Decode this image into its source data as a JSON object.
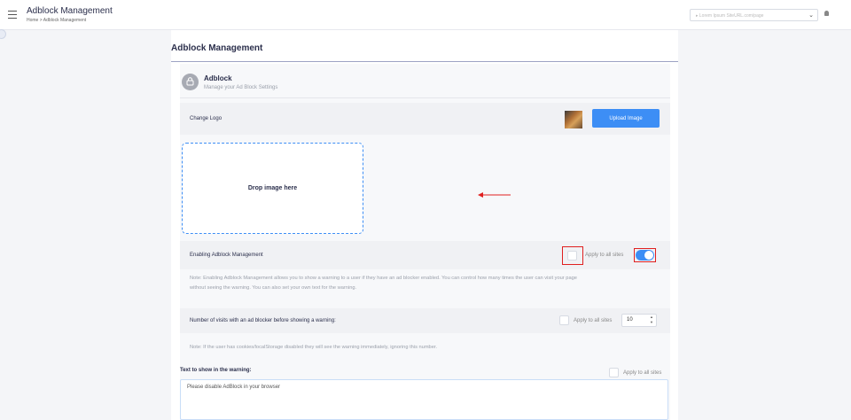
{
  "header": {
    "title": "Adblock Management",
    "breadcrumb_home": "Home",
    "breadcrumb_sep": ">",
    "breadcrumb_current": "Adblock Management",
    "site_select_value": "▸ Lorem Ipsum SiteURL.com/page"
  },
  "page": {
    "title": "Adblock Management"
  },
  "card": {
    "title": "Adblock",
    "subtitle": "Manage your Ad Block Settings"
  },
  "logo": {
    "label": "Change Logo",
    "upload_button": "Upload Image",
    "drop_text": "Drop image here"
  },
  "enable": {
    "label": "Enabling Adblock Management",
    "apply_label": "Apply to all sites",
    "toggle_on": true,
    "note_line1": "Note: Enabling Adblock Management allows you to show a warning to a user if they have an ad blocker enabled. You can control how many times the user can visit your page",
    "note_line2": "without seeing the warning. You can also set your own text for the warning."
  },
  "visits": {
    "label": "Number of visits with an ad blocker before showing a warning:",
    "apply_label": "Apply to all sites",
    "value": "10",
    "note": "Note: If the user has cookies/localStorage disabled they will see the warning immediately, ignoring this number."
  },
  "warning": {
    "label": "Text to show in the warning:",
    "apply_label": "Apply to all sites",
    "text": "Please disable AdBlock in your browser"
  },
  "colors": {
    "accent": "#3d8ef5",
    "highlight": "#e02020"
  }
}
